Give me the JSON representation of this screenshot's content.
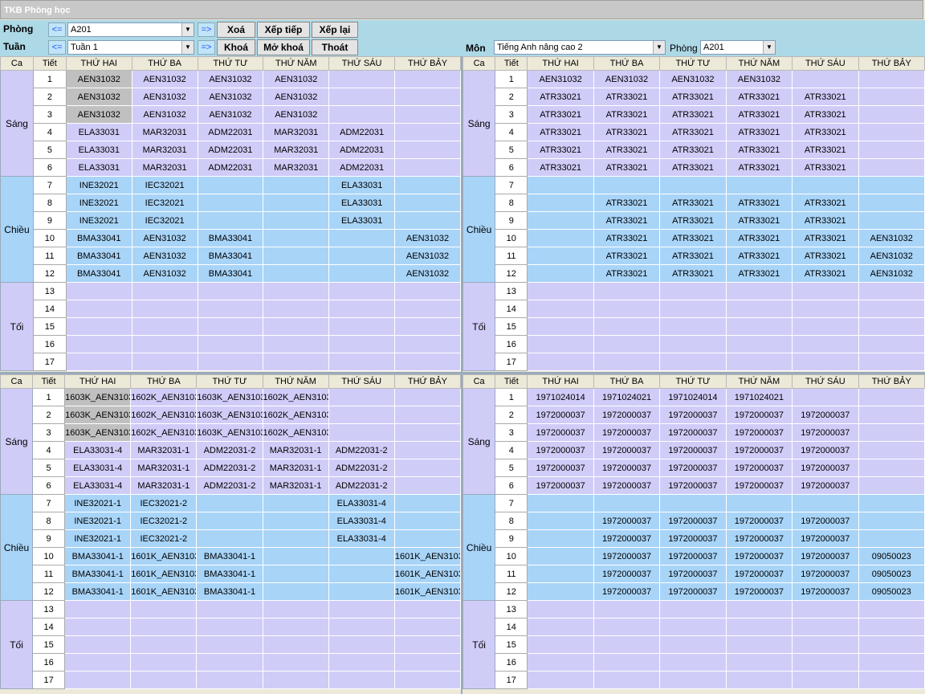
{
  "window": {
    "title": "TKB Phòng học"
  },
  "toolbar": {
    "phong_label": "Phòng",
    "tuan_label": "Tuần",
    "back_label": "<=",
    "fwd_label": "=>",
    "phong_value": "A201",
    "tuan_value": "Tuần 1",
    "buttons": {
      "xoa": "Xoá",
      "xeptiep": "Xếp tiếp",
      "xeplai": "Xếp lại",
      "khoa": "Khoá",
      "mokhoa": "Mở khoá",
      "thoat": "Thoát"
    },
    "mon_label": "Môn",
    "mon_value": "Tiếng Anh nâng cao 2",
    "phong2_label": "Phòng",
    "phong2_value": "A201"
  },
  "headers": [
    "Ca",
    "Tiết",
    "THỨ HAI",
    "THỨ BA",
    "THỨ TƯ",
    "THỨ NĂM",
    "THỨ SÁU",
    "THỨ BẢY"
  ],
  "sessions": [
    {
      "name": "Sáng",
      "start": 1,
      "rows": 6
    },
    {
      "name": "Chiều",
      "start": 7,
      "rows": 6
    },
    {
      "name": "Tối",
      "start": 13,
      "rows": 5
    }
  ],
  "grids": {
    "tl": {
      "rows": [
        [
          "AEN31032",
          "AEN31032",
          "AEN31032",
          "AEN31032",
          "",
          ""
        ],
        [
          "AEN31032",
          "AEN31032",
          "AEN31032",
          "AEN31032",
          "",
          ""
        ],
        [
          "AEN31032",
          "AEN31032",
          "AEN31032",
          "AEN31032",
          "",
          ""
        ],
        [
          "ELA33031",
          "MAR32031",
          "ADM22031",
          "MAR32031",
          "ADM22031",
          ""
        ],
        [
          "ELA33031",
          "MAR32031",
          "ADM22031",
          "MAR32031",
          "ADM22031",
          ""
        ],
        [
          "ELA33031",
          "MAR32031",
          "ADM22031",
          "MAR32031",
          "ADM22031",
          ""
        ],
        [
          "INE32021",
          "IEC32021",
          "",
          "",
          "ELA33031",
          ""
        ],
        [
          "INE32021",
          "IEC32021",
          "",
          "",
          "ELA33031",
          ""
        ],
        [
          "INE32021",
          "IEC32021",
          "",
          "",
          "ELA33031",
          ""
        ],
        [
          "BMA33041",
          "AEN31032",
          "BMA33041",
          "",
          "",
          "AEN31032"
        ],
        [
          "BMA33041",
          "AEN31032",
          "BMA33041",
          "",
          "",
          "AEN31032"
        ],
        [
          "BMA33041",
          "AEN31032",
          "BMA33041",
          "",
          "",
          "AEN31032"
        ],
        [
          "",
          "",
          "",
          "",
          "",
          ""
        ],
        [
          "",
          "",
          "",
          "",
          "",
          ""
        ],
        [
          "",
          "",
          "",
          "",
          "",
          ""
        ],
        [
          "",
          "",
          "",
          "",
          "",
          ""
        ],
        [
          "",
          "",
          "",
          "",
          "",
          ""
        ]
      ]
    },
    "tr": {
      "rows": [
        [
          "AEN31032",
          "AEN31032",
          "AEN31032",
          "AEN31032",
          "",
          ""
        ],
        [
          "ATR33021",
          "ATR33021",
          "ATR33021",
          "ATR33021",
          "ATR33021",
          ""
        ],
        [
          "ATR33021",
          "ATR33021",
          "ATR33021",
          "ATR33021",
          "ATR33021",
          ""
        ],
        [
          "ATR33021",
          "ATR33021",
          "ATR33021",
          "ATR33021",
          "ATR33021",
          ""
        ],
        [
          "ATR33021",
          "ATR33021",
          "ATR33021",
          "ATR33021",
          "ATR33021",
          ""
        ],
        [
          "ATR33021",
          "ATR33021",
          "ATR33021",
          "ATR33021",
          "ATR33021",
          ""
        ],
        [
          "",
          "",
          "",
          "",
          "",
          ""
        ],
        [
          "",
          "ATR33021",
          "ATR33021",
          "ATR33021",
          "ATR33021",
          ""
        ],
        [
          "",
          "ATR33021",
          "ATR33021",
          "ATR33021",
          "ATR33021",
          ""
        ],
        [
          "",
          "ATR33021",
          "ATR33021",
          "ATR33021",
          "ATR33021",
          "AEN31032"
        ],
        [
          "",
          "ATR33021",
          "ATR33021",
          "ATR33021",
          "ATR33021",
          "AEN31032"
        ],
        [
          "",
          "ATR33021",
          "ATR33021",
          "ATR33021",
          "ATR33021",
          "AEN31032"
        ],
        [
          "",
          "",
          "",
          "",
          "",
          ""
        ],
        [
          "",
          "",
          "",
          "",
          "",
          ""
        ],
        [
          "",
          "",
          "",
          "",
          "",
          ""
        ],
        [
          "",
          "",
          "",
          "",
          "",
          ""
        ],
        [
          "",
          "",
          "",
          "",
          "",
          ""
        ]
      ]
    },
    "bl": {
      "rows": [
        [
          "1603K_AEN3103",
          "1602K_AEN3103",
          "1603K_AEN3103",
          "1602K_AEN3103",
          "",
          ""
        ],
        [
          "1603K_AEN3103",
          "1602K_AEN3103",
          "1603K_AEN3103",
          "1602K_AEN3103",
          "",
          ""
        ],
        [
          "1603K_AEN3103",
          "1602K_AEN3103",
          "1603K_AEN3103",
          "1602K_AEN3103",
          "",
          ""
        ],
        [
          "ELA33031-4",
          "MAR32031-1",
          "ADM22031-2",
          "MAR32031-1",
          "ADM22031-2",
          ""
        ],
        [
          "ELA33031-4",
          "MAR32031-1",
          "ADM22031-2",
          "MAR32031-1",
          "ADM22031-2",
          ""
        ],
        [
          "ELA33031-4",
          "MAR32031-1",
          "ADM22031-2",
          "MAR32031-1",
          "ADM22031-2",
          ""
        ],
        [
          "INE32021-1",
          "IEC32021-2",
          "",
          "",
          "ELA33031-4",
          ""
        ],
        [
          "INE32021-1",
          "IEC32021-2",
          "",
          "",
          "ELA33031-4",
          ""
        ],
        [
          "INE32021-1",
          "IEC32021-2",
          "",
          "",
          "ELA33031-4",
          ""
        ],
        [
          "BMA33041-1",
          "1601K_AEN3103",
          "BMA33041-1",
          "",
          "",
          "1601K_AEN3103"
        ],
        [
          "BMA33041-1",
          "1601K_AEN3103",
          "BMA33041-1",
          "",
          "",
          "1601K_AEN3103"
        ],
        [
          "BMA33041-1",
          "1601K_AEN3103",
          "BMA33041-1",
          "",
          "",
          "1601K_AEN3103"
        ],
        [
          "",
          "",
          "",
          "",
          "",
          ""
        ],
        [
          "",
          "",
          "",
          "",
          "",
          ""
        ],
        [
          "",
          "",
          "",
          "",
          "",
          ""
        ],
        [
          "",
          "",
          "",
          "",
          "",
          ""
        ],
        [
          "",
          "",
          "",
          "",
          "",
          ""
        ]
      ]
    },
    "br": {
      "rows": [
        [
          "1971024014",
          "1971024021",
          "1971024014",
          "1971024021",
          "",
          ""
        ],
        [
          "1972000037",
          "1972000037",
          "1972000037",
          "1972000037",
          "1972000037",
          ""
        ],
        [
          "1972000037",
          "1972000037",
          "1972000037",
          "1972000037",
          "1972000037",
          ""
        ],
        [
          "1972000037",
          "1972000037",
          "1972000037",
          "1972000037",
          "1972000037",
          ""
        ],
        [
          "1972000037",
          "1972000037",
          "1972000037",
          "1972000037",
          "1972000037",
          ""
        ],
        [
          "1972000037",
          "1972000037",
          "1972000037",
          "1972000037",
          "1972000037",
          ""
        ],
        [
          "",
          "",
          "",
          "",
          "",
          ""
        ],
        [
          "",
          "1972000037",
          "1972000037",
          "1972000037",
          "1972000037",
          ""
        ],
        [
          "",
          "1972000037",
          "1972000037",
          "1972000037",
          "1972000037",
          ""
        ],
        [
          "",
          "1972000037",
          "1972000037",
          "1972000037",
          "1972000037",
          "09050023"
        ],
        [
          "",
          "1972000037",
          "1972000037",
          "1972000037",
          "1972000037",
          "09050023"
        ],
        [
          "",
          "1972000037",
          "1972000037",
          "1972000037",
          "1972000037",
          "09050023"
        ],
        [
          "",
          "",
          "",
          "",
          "",
          ""
        ],
        [
          "",
          "",
          "",
          "",
          "",
          ""
        ],
        [
          "",
          "",
          "",
          "",
          "",
          ""
        ],
        [
          "",
          "",
          "",
          "",
          "",
          ""
        ],
        [
          "",
          "",
          "",
          "",
          "",
          ""
        ]
      ]
    }
  },
  "colors": {
    "morning": "#d0ccf8",
    "afternoon": "#a8d4f8",
    "selected": "#c0c0c0",
    "toolbar": "#add8e6"
  }
}
